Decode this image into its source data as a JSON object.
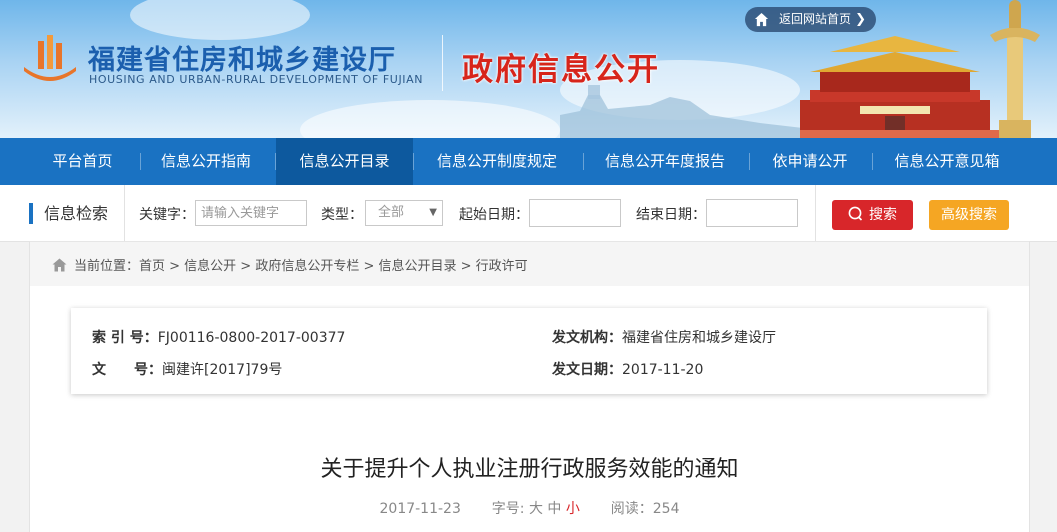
{
  "header": {
    "site_name_cn": "福建省住房和城乡建设厅",
    "site_name_en": "HOUSING AND URBAN-RURAL DEVELOPMENT OF FUJIAN",
    "section_title": "政府信息公开",
    "back_home_label": "返回网站首页"
  },
  "nav": {
    "items": [
      {
        "label": "平台首页"
      },
      {
        "label": "信息公开指南"
      },
      {
        "label": "信息公开目录",
        "active": true
      },
      {
        "label": "信息公开制度规定"
      },
      {
        "label": "信息公开年度报告"
      },
      {
        "label": "依申请公开"
      },
      {
        "label": "信息公开意见箱"
      }
    ]
  },
  "search": {
    "title": "信息检索",
    "keyword_label": "关键字：",
    "keyword_placeholder": "请输入关键字",
    "type_label": "类型：",
    "type_value": "全部",
    "start_label": "起始日期：",
    "end_label": "结束日期：",
    "search_button": "搜索",
    "advanced_button": "高级搜索"
  },
  "breadcrumb": {
    "prefix": "当前位置：",
    "path": "首页 > 信息公开 > 政府信息公开专栏 > 信息公开目录 > 行政许可"
  },
  "meta": {
    "index_label": "索 引 号：",
    "index_value": "FJ00116-0800-2017-00377",
    "docno_label": "文　　号：",
    "docno_value": "闽建许[2017]79号",
    "issuer_label": "发文机构：",
    "issuer_value": "福建省住房和城乡建设厅",
    "date_label": "发文日期：",
    "date_value": "2017-11-20"
  },
  "article": {
    "title": "关于提升个人执业注册行政服务效能的通知",
    "publish_date": "2017-11-23",
    "font_size_label": "字号:",
    "font_large": "大",
    "font_medium": "中",
    "font_small": "小",
    "reads_label": "阅读：",
    "reads_value": "254"
  },
  "colors": {
    "nav_bg": "#1a72c2",
    "nav_active": "#0d599e",
    "search_button": "#d8262a",
    "advanced_button": "#f5a623",
    "section_title": "#d7251b",
    "site_name": "#1b5fae"
  },
  "icons": {
    "logo": "building-logo-icon",
    "home": "home-icon",
    "search": "magnifier-icon",
    "breadcrumb": "house-icon"
  }
}
